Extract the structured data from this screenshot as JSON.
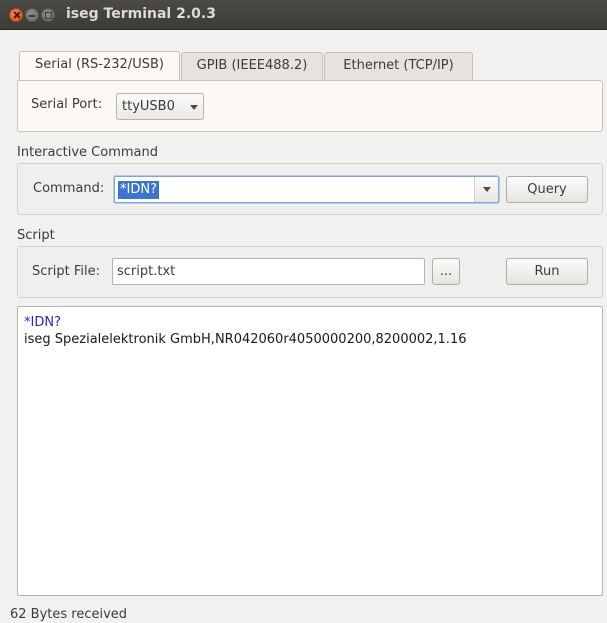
{
  "window": {
    "title": "iseg Terminal 2.0.3"
  },
  "tabs": [
    {
      "label": "Serial (RS-232/USB)",
      "active": true
    },
    {
      "label": "GPIB (IEEE488.2)",
      "active": false
    },
    {
      "label": "Ethernet (TCP/IP)",
      "active": false
    }
  ],
  "serial": {
    "port_label": "Serial Port:",
    "port_value": "ttyUSB0"
  },
  "interactive": {
    "section_title": "Interactive Command",
    "command_label": "Command:",
    "command_value": "*IDN?",
    "query_label": "Query"
  },
  "script": {
    "section_title": "Script",
    "file_label": "Script File:",
    "file_value": "script.txt",
    "browse_label": "...",
    "run_label": "Run"
  },
  "output": {
    "lines": [
      {
        "type": "command",
        "text": "*IDN?"
      },
      {
        "type": "response",
        "text": "iseg Spezialelektronik GmbH,NR042060r4050000200,8200002,1.16"
      }
    ]
  },
  "status": {
    "text": "62 Bytes received"
  },
  "colors": {
    "command_text": "#2626d8",
    "selection": "#3b75cd",
    "titlebar": "#3c3b37",
    "close_button": "#df4a16"
  }
}
